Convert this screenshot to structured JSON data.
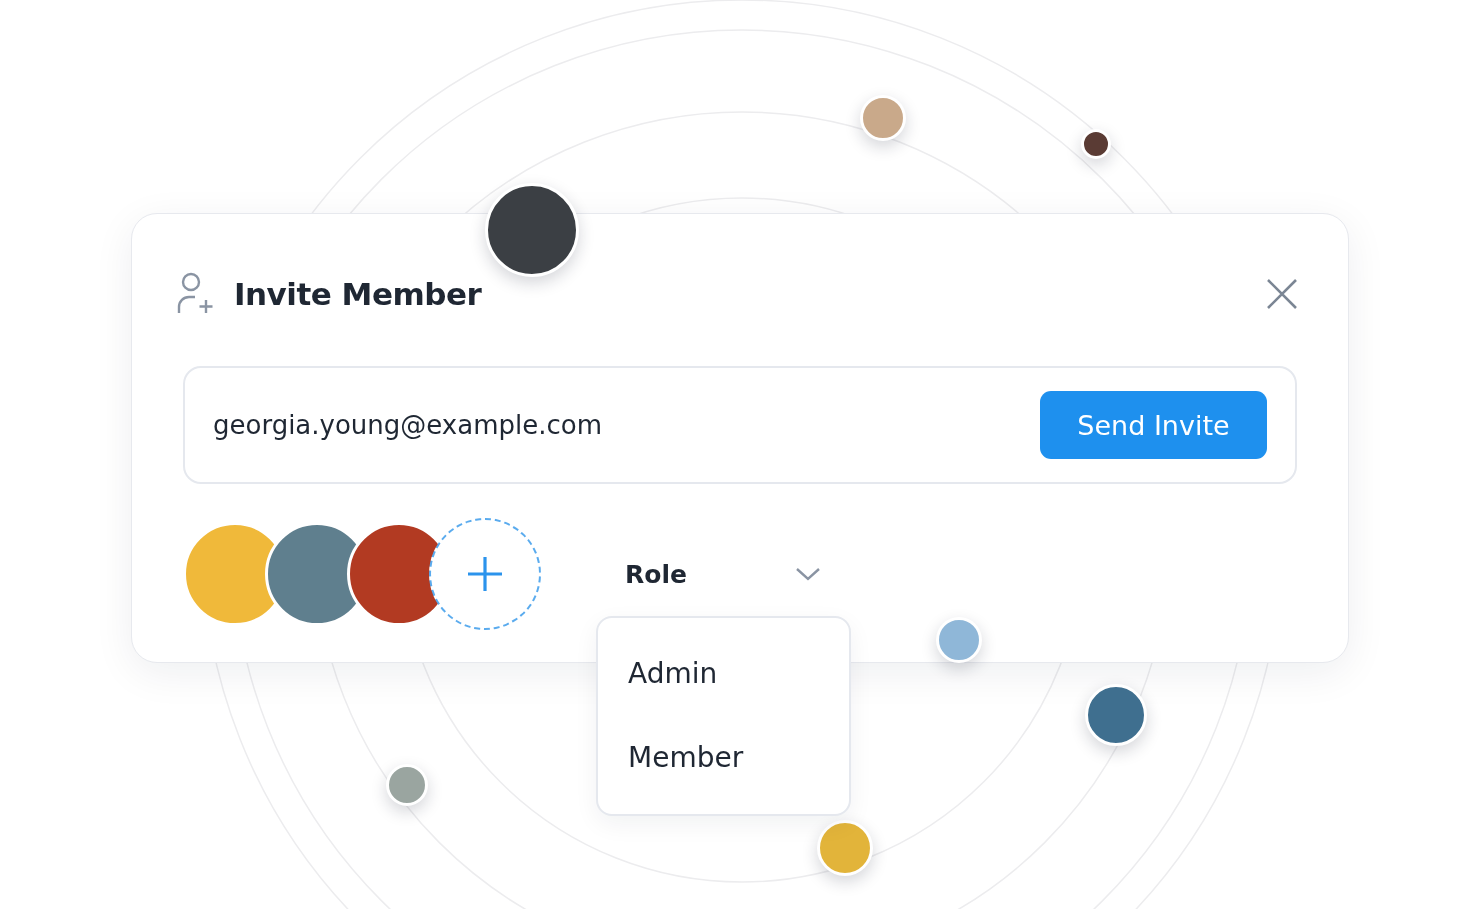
{
  "dialog": {
    "title": "Invite Member",
    "email": {
      "value": "georgia.young@example.com"
    },
    "send_button": "Send Invite",
    "role": {
      "label": "Role",
      "expanded": true,
      "options": [
        "Admin",
        "Member"
      ]
    }
  }
}
